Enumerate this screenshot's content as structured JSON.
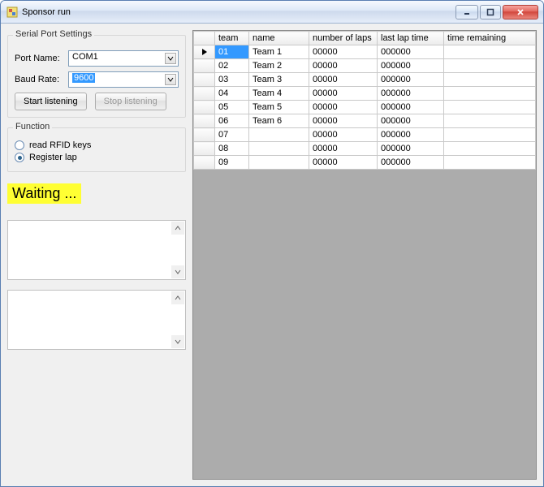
{
  "window": {
    "title": "Sponsor run"
  },
  "serial": {
    "group_label": "Serial Port Settings",
    "port_label": "Port Name:",
    "port_value": "COM1",
    "baud_label": "Baud Rate:",
    "baud_value": "9600",
    "start_btn": "Start listening",
    "stop_btn": "Stop listening"
  },
  "func": {
    "group_label": "Function",
    "opt_read": "read RFID keys",
    "opt_register": "Register lap",
    "selected": "register"
  },
  "status": "Waiting ...",
  "grid": {
    "headers": {
      "team": "team",
      "name": "name",
      "laps": "number of laps",
      "last": "last lap time",
      "remain": "time remaining"
    },
    "rows": [
      {
        "team": "01",
        "name": "Team 1",
        "laps": "00000",
        "last": "000000",
        "remain": ""
      },
      {
        "team": "02",
        "name": "Team 2",
        "laps": "00000",
        "last": "000000",
        "remain": ""
      },
      {
        "team": "03",
        "name": "Team 3",
        "laps": "00000",
        "last": "000000",
        "remain": ""
      },
      {
        "team": "04",
        "name": "Team 4",
        "laps": "00000",
        "last": "000000",
        "remain": ""
      },
      {
        "team": "05",
        "name": "Team 5",
        "laps": "00000",
        "last": "000000",
        "remain": ""
      },
      {
        "team": "06",
        "name": "Team 6",
        "laps": "00000",
        "last": "000000",
        "remain": ""
      },
      {
        "team": "07",
        "name": "",
        "laps": "00000",
        "last": "000000",
        "remain": ""
      },
      {
        "team": "08",
        "name": "",
        "laps": "00000",
        "last": "000000",
        "remain": ""
      },
      {
        "team": "09",
        "name": "",
        "laps": "00000",
        "last": "000000",
        "remain": ""
      }
    ],
    "selected_row": 0
  }
}
